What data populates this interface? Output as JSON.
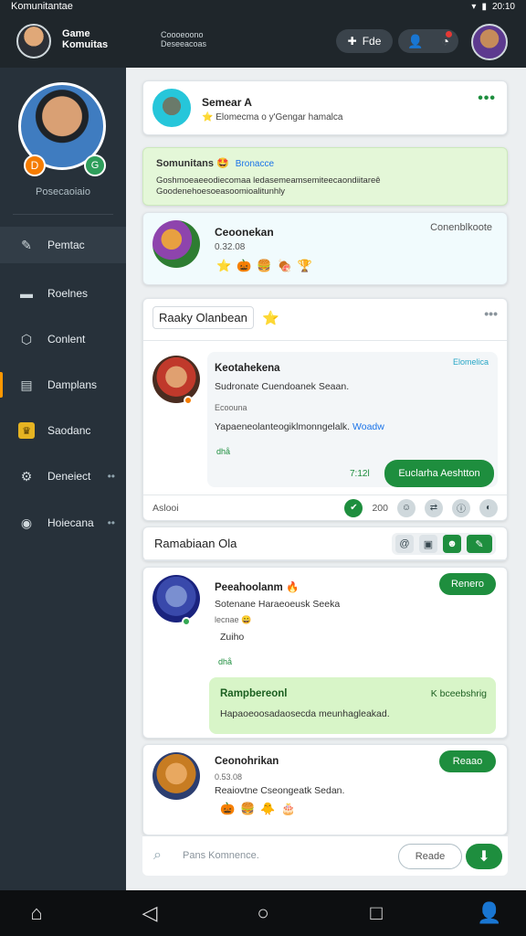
{
  "status": {
    "app_name": "Komunitantae",
    "time": "20:10",
    "icons": [
      "wifi-icon",
      "signal-icon",
      "battery-icon"
    ]
  },
  "topbar": {
    "title_line1": "Game",
    "title_line2": "Komuitas",
    "sub_line1": "Coooeoono",
    "sub_line2": "Deseeacoas",
    "pill_label": "Fde",
    "icons": [
      "user-icon",
      "notification-icon"
    ]
  },
  "sidebar": {
    "profile_name": "Posecaoiaio",
    "badge_left": "D",
    "badge_right": "G",
    "items": [
      {
        "label": "Pemtac",
        "icon": "edit-icon",
        "glyph": "✎"
      },
      {
        "label": "Roelnes",
        "icon": "card-icon",
        "glyph": "▬"
      },
      {
        "label": "Conlent",
        "icon": "shield-icon",
        "glyph": "⬡"
      },
      {
        "label": "Damplans",
        "icon": "calendar-icon",
        "glyph": "▤"
      },
      {
        "label": "Saodanc",
        "icon": "trophy-icon",
        "glyph": "♛"
      },
      {
        "label": "Deneiect",
        "icon": "gear-icon",
        "glyph": "⚙"
      },
      {
        "label": "Hoiecana",
        "icon": "gamepad-icon",
        "glyph": "◉"
      }
    ],
    "more_glyph": "••"
  },
  "card1": {
    "title": "Semear",
    "title_suffix": "A",
    "subtitle": "Elomecma o y'Gengar hamalca",
    "star": "⭐",
    "menu": "•••"
  },
  "banner": {
    "title": "Somunitans",
    "emoji": "🤩",
    "link": "Bronacce",
    "body_line1": "Goshmoeaeeodiecomaa ledasemeamsemiteecaondiitareȇ",
    "body_line2": "Goodenehoesoeasoomioalitunhly"
  },
  "card3": {
    "title": "Ceoonekan",
    "subtitle": "0.32.08",
    "right": "Conenblkoote",
    "emojis": [
      "⭐",
      "🎃",
      "🍔",
      "🍖",
      "🏆"
    ]
  },
  "section1": {
    "title": "Raaky Olanbean",
    "star": "⭐",
    "menu": "•••",
    "message": {
      "name": "Keotahekena",
      "line1": "Sudronate Cuendoanek Seaan.",
      "small": "Ecoouna",
      "line2": "Yapaeneolanteogiklmonngelalk.",
      "line2_link": "Woadw",
      "reply": "dhå",
      "time": "7:12l",
      "corner_link": "Elomelica",
      "button": "Euclarha Aeshtton"
    },
    "action_label": "Aslooi",
    "action_count": "200",
    "action_icons": [
      "like-icon",
      "user-icon",
      "share-icon",
      "info-icon",
      "reaction-icon"
    ]
  },
  "section2": {
    "title": "Ramabiaan Ola",
    "tools": [
      "mention-icon",
      "image-icon",
      "emoji-icon",
      "edit-icon"
    ],
    "post1": {
      "name": "Peeahoolanm",
      "name_emoji": "🔥",
      "line1": "Sotenane Haraeoeusk Seeka",
      "small1": "lecnae",
      "small1_emoji": "😄",
      "small2": "Zuiho",
      "reply": "dhå",
      "tag": "Renero",
      "quote_title": "Rampbereonl",
      "quote_right": "K bceebshrig",
      "quote_body": "Hapaoeoosadaosecda meunhagleakad."
    },
    "post2": {
      "name": "Ceonohrikan",
      "sub": "0.53.08",
      "line1": "Reaiovtne Cseongeatk Sedan.",
      "emojis": [
        "🎃",
        "🍔",
        "🐥",
        "🎂"
      ],
      "tag": "Reaao"
    }
  },
  "composer": {
    "placeholder": "Pans Komnence.",
    "button": "Reade",
    "send_glyph": "⬇"
  },
  "navbar": [
    "home-icon",
    "back-icon",
    "circle-home-icon",
    "recent-apps-icon",
    "profile-icon"
  ],
  "colors": {
    "accent_green": "#1e8e3e",
    "sidebar_bg": "#27313a",
    "topbar_bg": "#1f262b",
    "badge_orange": "#f57c00"
  }
}
